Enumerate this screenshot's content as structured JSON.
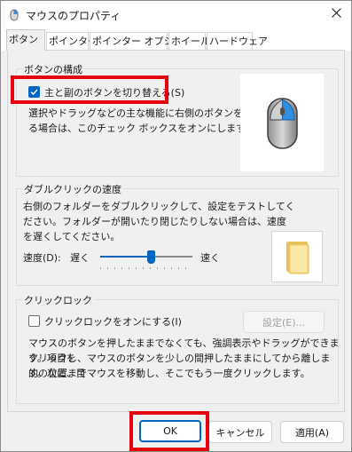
{
  "window": {
    "title": "マウスのプロパティ"
  },
  "tabs": [
    {
      "label": "ボタン"
    },
    {
      "label": "ポインター"
    },
    {
      "label": "ポインター オプション"
    },
    {
      "label": "ホイール"
    },
    {
      "label": "ハードウェア"
    }
  ],
  "button_config": {
    "title": "ボタンの構成",
    "checkbox_label": "主と副のボタンを切り替える(S)",
    "checked": true,
    "description_line1": "選択やドラッグなどの主な機能に右側のボタンを使用す",
    "description_line2": "る場合は、このチェック ボックスをオンにします。"
  },
  "double_click": {
    "title": "ダブルクリックの速度",
    "description_line1": "右側のフォルダーをダブルクリックして、設定をテストしてく",
    "description_line2": "ださい。フォルダーが開いたり閉じたりしない場合は、速度",
    "description_line3": "を遅くしてください。",
    "speed_label": "速度(D):",
    "slow_label": "遅く",
    "fast_label": "速く",
    "speed_value": 0.55
  },
  "click_lock": {
    "title": "クリックロック",
    "checkbox_label": "クリックロックをオンにする(I)",
    "checked": false,
    "settings_button": "設定(E)...",
    "description_line1": "マウスのボタンを押したままでなくても、強調表示やドラッグができます。項目を",
    "description_line2": "クリックし、マウスのボタンを少しの間押したままにしてから離します。次に、目",
    "description_line3": "的の位置までマウスを移動し、そこでもう一度クリックします。"
  },
  "footer": {
    "ok": "OK",
    "cancel": "キャンセル",
    "apply": "適用(A)"
  },
  "colors": {
    "accent": "#0067c0",
    "highlight_frame": "#e8000f"
  }
}
